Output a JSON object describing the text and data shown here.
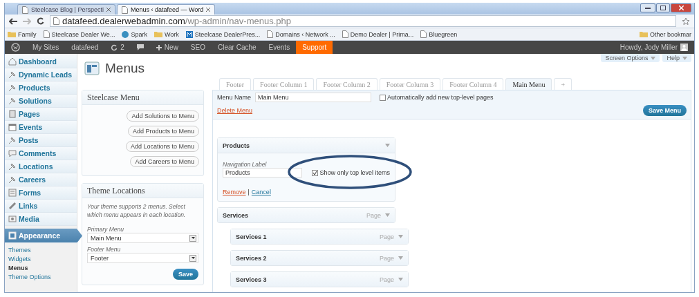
{
  "browser": {
    "tabs": [
      {
        "label": "Steelcase Blog | Perspecti",
        "selected": false
      },
      {
        "label": "Menus ‹ datafeed — Word",
        "selected": true
      }
    ],
    "address": {
      "host": "datafeed.dealerwebadmin.com",
      "path": "/wp-admin/nav-menus.php"
    },
    "bookmarks": [
      {
        "label": "Family",
        "kind": "folder"
      },
      {
        "label": "Steelcase Dealer We...",
        "kind": "page"
      },
      {
        "label": "Spark",
        "kind": "globe"
      },
      {
        "label": "Work",
        "kind": "folder"
      },
      {
        "label": "Steelcase DealerPres...",
        "kind": "m"
      },
      {
        "label": "Domains ‹ Network ...",
        "kind": "page"
      },
      {
        "label": "Demo Dealer | Prima...",
        "kind": "page"
      },
      {
        "label": "Bluegreen",
        "kind": "page"
      }
    ],
    "other_bookmarks": "Other bookmar"
  },
  "admin_bar": {
    "items": [
      {
        "label": "My Sites",
        "kind": "text",
        "selected": false
      },
      {
        "label": "datafeed",
        "kind": "text",
        "selected": false
      },
      {
        "label": "2",
        "kind": "updates",
        "selected": false
      },
      {
        "kind": "comments",
        "selected": false
      },
      {
        "label": "New",
        "kind": "new",
        "selected": false
      },
      {
        "label": "SEO",
        "kind": "text",
        "selected": false
      },
      {
        "label": "Clear Cache",
        "kind": "text",
        "selected": false
      },
      {
        "label": "Events",
        "kind": "text",
        "selected": false
      },
      {
        "label": "Support",
        "kind": "text",
        "selected": true
      }
    ],
    "greeting": "Howdy, Jody Miller"
  },
  "sidebar": {
    "items": [
      {
        "label": "Dashboard",
        "kind": "home",
        "selected": false
      },
      {
        "label": "Dynamic Leads",
        "kind": "pin",
        "selected": false
      },
      {
        "label": "Products",
        "kind": "pin",
        "selected": false
      },
      {
        "label": "Solutions",
        "kind": "pin",
        "selected": false
      },
      {
        "label": "Pages",
        "kind": "page",
        "selected": false
      },
      {
        "label": "Events",
        "kind": "calendar",
        "selected": false
      },
      {
        "label": "Posts",
        "kind": "pin",
        "selected": false
      },
      {
        "label": "Comments",
        "kind": "comment",
        "selected": false
      },
      {
        "label": "Locations",
        "kind": "pin",
        "selected": false
      },
      {
        "label": "Careers",
        "kind": "pin",
        "selected": false
      },
      {
        "label": "Forms",
        "kind": "form",
        "selected": false
      },
      {
        "label": "Links",
        "kind": "link",
        "selected": false
      },
      {
        "label": "Media",
        "kind": "media",
        "selected": false
      },
      {
        "label": "Appearance",
        "kind": "appearance",
        "selected": true,
        "submenu": [
          {
            "label": "Themes",
            "selected": false
          },
          {
            "label": "Widgets",
            "selected": false
          },
          {
            "label": "Menus",
            "selected": true
          },
          {
            "label": "Theme Options",
            "selected": false
          }
        ]
      }
    ]
  },
  "page_title": "Menus",
  "screen_options": [
    "Screen Options",
    "Help"
  ],
  "steelcase_menu": {
    "title": "Steelcase Menu",
    "buttons": [
      "Add Solutions to Menu",
      "Add Products to Menu",
      "Add Locations to Menu",
      "Add Careers to Menu"
    ]
  },
  "theme_locations": {
    "title": "Theme Locations",
    "note": "Your theme supports 2 menus. Select which menu appears in each location.",
    "fields": [
      {
        "label": "Primary Menu",
        "value": "Main Menu"
      },
      {
        "label": "Footer Menu",
        "value": "Footer"
      }
    ],
    "save": "Save"
  },
  "menu_tabs": [
    {
      "label": "Footer",
      "selected": false
    },
    {
      "label": "Footer Column 1",
      "selected": false
    },
    {
      "label": "Footer Column 2",
      "selected": false
    },
    {
      "label": "Footer Column 3",
      "selected": false
    },
    {
      "label": "Footer Column 4",
      "selected": false
    },
    {
      "label": "Main Menu",
      "selected": true
    },
    {
      "label": "+",
      "selected": false
    }
  ],
  "menu_header": {
    "name_label": "Menu Name",
    "name_value": "Main Menu",
    "auto_add": {
      "label": "Automatically add new top-level pages",
      "checked": false
    },
    "delete": "Delete Menu",
    "save": "Save Menu"
  },
  "menu_items": [
    {
      "title": "Products",
      "expanded": true,
      "nav_label": "Navigation Label",
      "nav_value": "Products",
      "option": {
        "label": "Show only top level items",
        "checked": true
      },
      "remove": "Remove",
      "separator": "|",
      "cancel": "Cancel"
    },
    {
      "title": "Services",
      "type": "Page",
      "expanded": false,
      "children": [
        {
          "title": "Services 1",
          "type": "Page",
          "expanded": false
        },
        {
          "title": "Services 2",
          "type": "Page",
          "expanded": false
        },
        {
          "title": "Services 3",
          "type": "Page",
          "expanded": false
        }
      ]
    }
  ]
}
